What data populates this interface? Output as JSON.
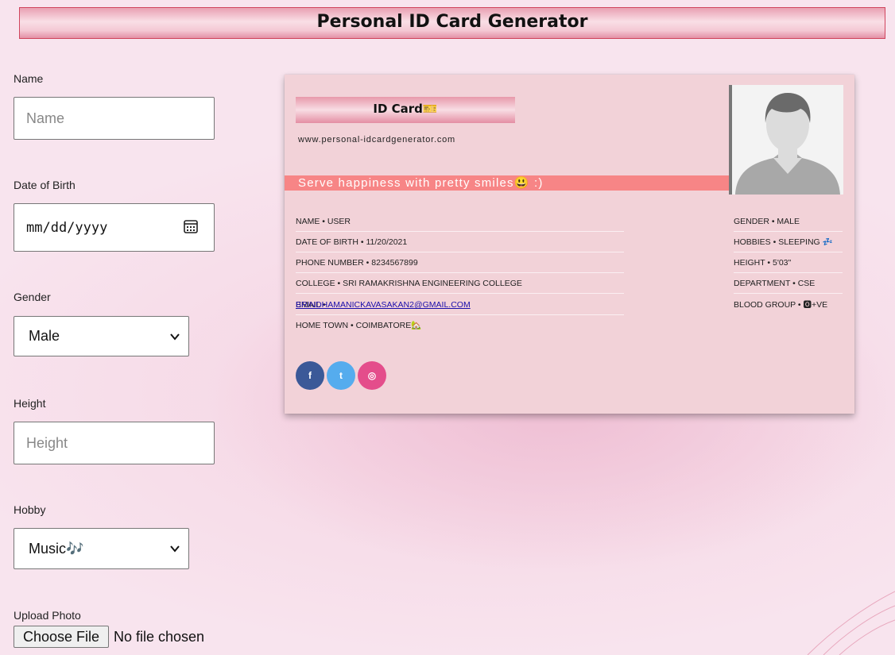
{
  "header": {
    "title": "Personal ID Card Generator"
  },
  "form": {
    "name_label": "Name",
    "name_placeholder": "Name",
    "dob_label": "Date of Birth",
    "dob_value": "mm/dd/yyyy",
    "gender_label": "Gender",
    "gender_value": "Male",
    "height_label": "Height",
    "height_placeholder": "Height",
    "hobby_label": "Hobby",
    "hobby_value": "Music🎶",
    "upload_label": "Upload Photo",
    "choose_file": "Choose File",
    "file_status": "No file chosen"
  },
  "card": {
    "title": "ID Card🎫",
    "website": "www.personal-idcardgenerator.com",
    "tagline": "Serve happiness with pretty smiles😃 :)",
    "left_rows": [
      {
        "text": "NAME • USER"
      },
      {
        "text": "DATE OF BIRTH • 11/20/2021"
      },
      {
        "text": "PHONE NUMBER • 8234567899"
      },
      {
        "text": "COLLEGE • SRI RAMAKRISHNA ENGINEERING COLLEGE"
      },
      {
        "prefix": "EMAIL • ",
        "link": "BRINDHAMANICKAVASAKAN2@GMAIL.COM"
      },
      {
        "text": "HOME TOWN • COIMBATORE🏡"
      }
    ],
    "right_rows": [
      {
        "text": "GENDER • MALE"
      },
      {
        "text": "HOBBIES • SLEEPING 💤"
      },
      {
        "text": "HEIGHT • 5'03\""
      },
      {
        "text": "DEPARTMENT • CSE"
      },
      {
        "text": "BLOOD GROUP • 🅾+VE"
      }
    ],
    "social": [
      {
        "icon": "facebook-icon",
        "glyph": "f",
        "color": "#3b5998"
      },
      {
        "icon": "twitter-icon",
        "glyph": "t",
        "color": "#55acee"
      },
      {
        "icon": "instagram-icon",
        "glyph": "◎",
        "color": "#e44d8b"
      }
    ]
  },
  "colors": {
    "header_border": "#d0455e",
    "tagline_bg": "#f78586",
    "card_bg": "#f2d2d8",
    "link": "#1a0dab"
  }
}
